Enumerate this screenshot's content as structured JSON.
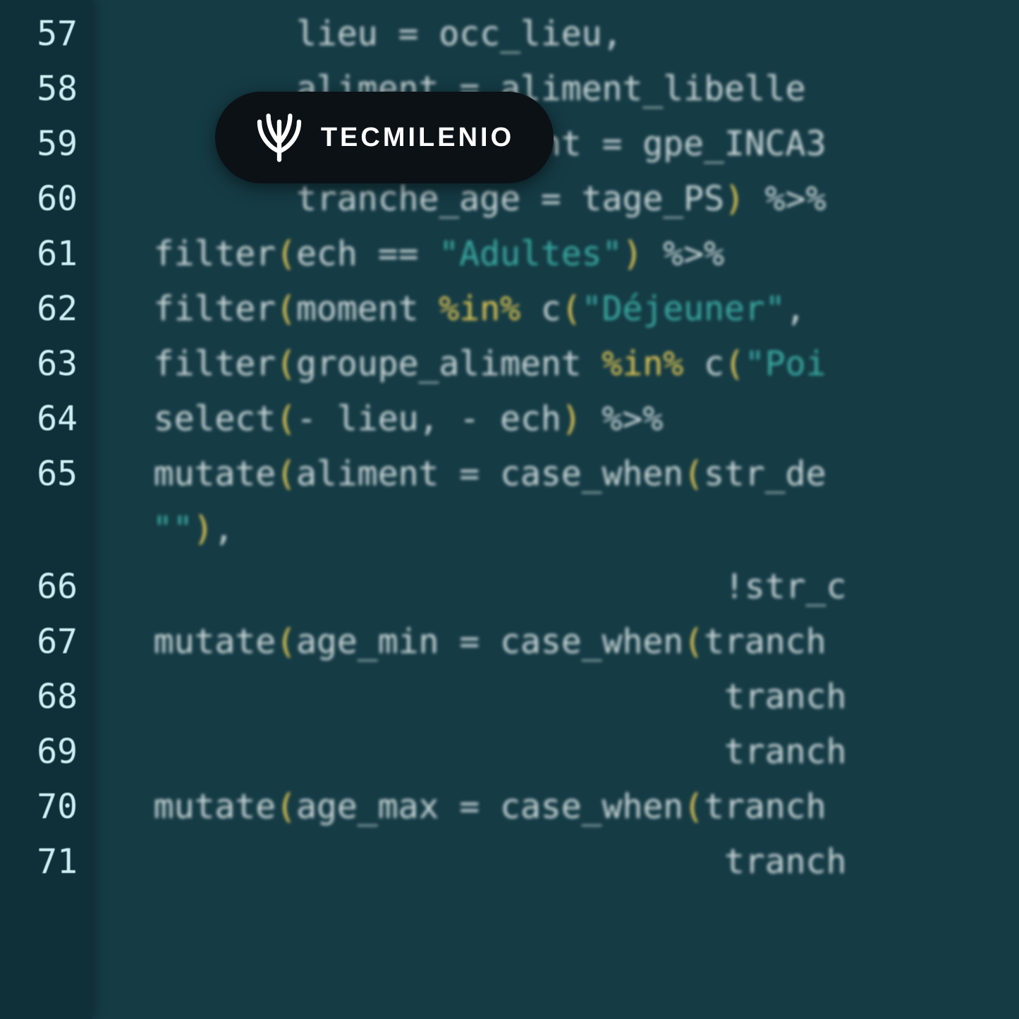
{
  "badge": {
    "text": "TECMILENIO"
  },
  "gutter": {
    "57": "57",
    "58": "58",
    "59": "59",
    "60": "60",
    "61": "61",
    "62": "62",
    "63": "63",
    "64": "64",
    "65": "65",
    "66": "66",
    "67": "67",
    "68": "68",
    "69": "69",
    "70": "70",
    "71": "71"
  },
  "code": {
    "l57": {
      "indent": "         ",
      "id": "lieu",
      "eq": " = ",
      "rhs": "occ_lieu,"
    },
    "l58": {
      "indent": "         ",
      "id": "aliment",
      "eq": " = ",
      "rhs": "aliment_libelle"
    },
    "l59": {
      "indent": "         ",
      "id": "groupe_aliment",
      "eq": " = ",
      "rhs": "gpe_INCA3"
    },
    "l60": {
      "indent": "         ",
      "id": "tranche_age",
      "eq": " = ",
      "rhs": "tage_PS",
      "close": ")",
      "pipe": " %>%"
    },
    "l61": {
      "indent": "  ",
      "fn": "filter",
      "open": "(",
      "a": "ech ",
      "eq2": "== ",
      "str": "\"Adultes\"",
      "close": ")",
      "pipe": " %>%"
    },
    "l62": {
      "indent": "  ",
      "fn": "filter",
      "open": "(",
      "a": "moment ",
      "inop": "%in%",
      "sp": " c",
      "open2": "(",
      "str": "\"Déjeuner\"",
      "comma": ","
    },
    "l63": {
      "indent": "  ",
      "fn": "filter",
      "open": "(",
      "a": "groupe_aliment ",
      "inop": "%in%",
      "sp": " c",
      "open2": "(",
      "str": "\"Poi"
    },
    "l64": {
      "indent": "  ",
      "fn": "select",
      "open": "(",
      "a": "- lieu, - ech",
      "close": ")",
      "pipe": " %>%"
    },
    "l65": {
      "indent": "  ",
      "fn": "mutate",
      "open": "(",
      "a": "aliment ",
      "eq": "= ",
      "b": "case_when",
      "open2": "(",
      "c": "str_de"
    },
    "l65b": {
      "str": "\"\"",
      "close": ")",
      "comma": ","
    },
    "l66": {
      "indent": "                              ",
      "not": "!",
      "a": "str_c"
    },
    "l67": {
      "indent": "  ",
      "fn": "mutate",
      "open": "(",
      "a": "age_min ",
      "eq": "= ",
      "b": "case_when",
      "open2": "(",
      "c": "tranch"
    },
    "l68": {
      "indent": "                              ",
      "a": "tranch"
    },
    "l69": {
      "indent": "                              ",
      "a": "tranch"
    },
    "l70": {
      "indent": "  ",
      "fn": "mutate",
      "open": "(",
      "a": "age_max ",
      "eq": "= ",
      "b": "case_when",
      "open2": "(",
      "c": "tranch"
    },
    "l71": {
      "indent": "                              ",
      "a": "tranch"
    }
  }
}
